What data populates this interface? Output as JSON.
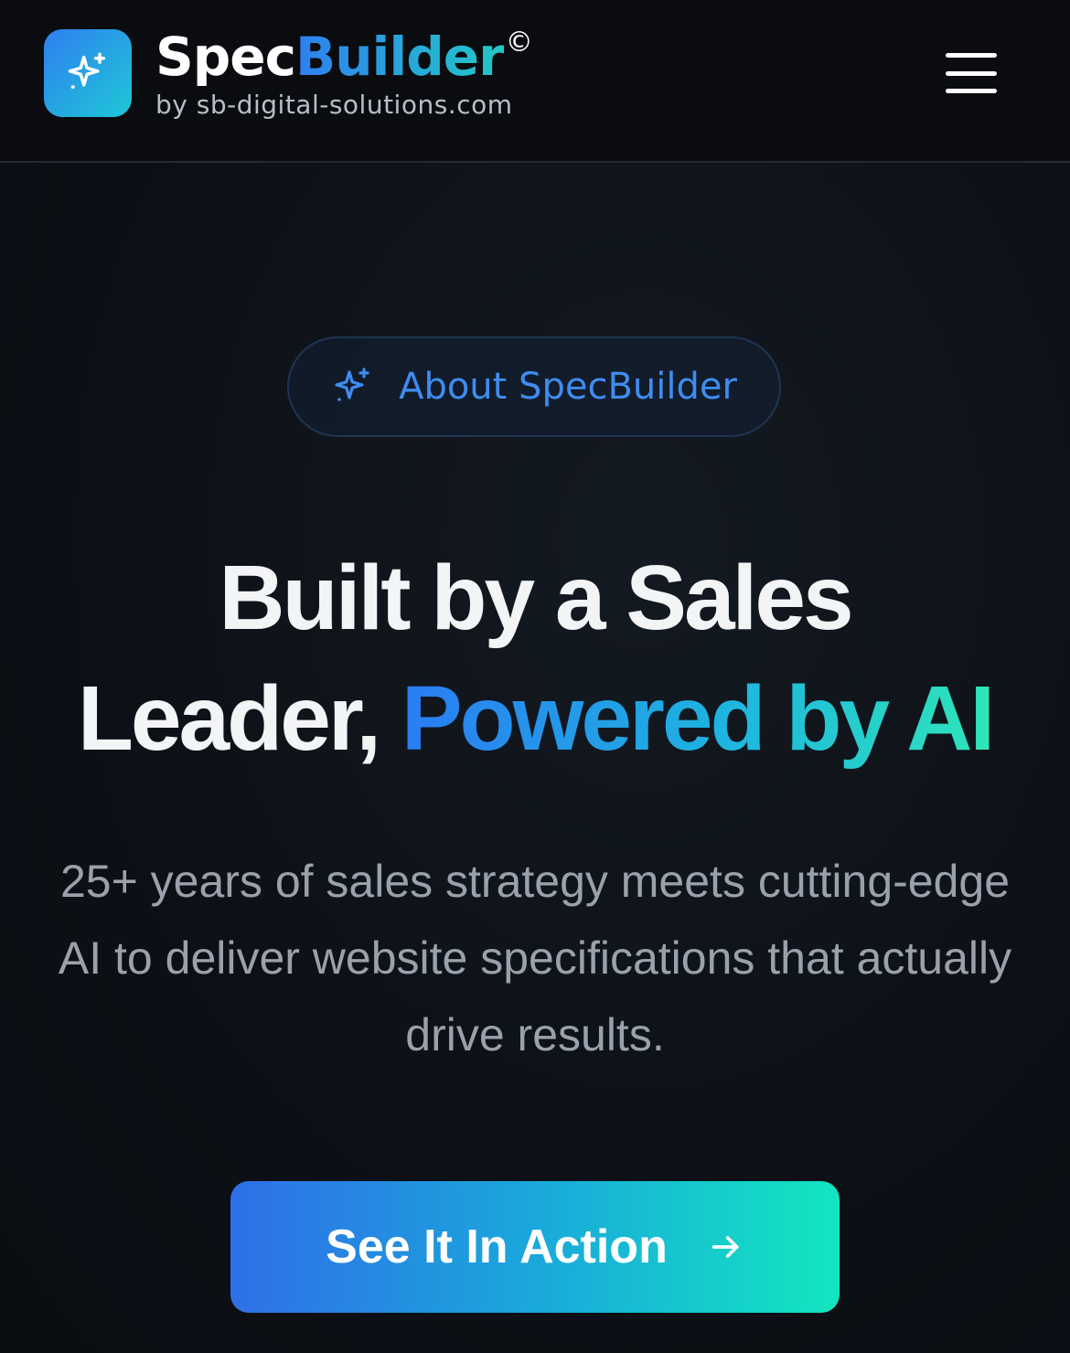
{
  "header": {
    "brand_part1": "Spec",
    "brand_part2": "Builder",
    "brand_mark": "©",
    "byline": "by sb-digital-solutions.com",
    "logo_icon": "sparkles-icon",
    "menu_icon": "hamburger-menu-icon"
  },
  "hero": {
    "pill_label": "About SpecBuilder",
    "pill_icon": "sparkles-icon",
    "headline_line1": "Built by a Sales",
    "headline_line2_plain": "Leader, ",
    "headline_line2_accent": "Powered by AI",
    "description": "25+ years of sales strategy meets cutting-edge AI to deliver website specifications that actually drive results.",
    "cta_label": "See It In Action",
    "cta_icon": "arrow-right-icon"
  },
  "colors": {
    "background": "#0d1117",
    "header_background": "#0a0c10",
    "accent_blue": "#2f7ff0",
    "accent_teal": "#22c9c6",
    "accent_green": "#12e6c0",
    "pill_text": "#3f8cf0",
    "body_text": "#9aa1ac"
  }
}
